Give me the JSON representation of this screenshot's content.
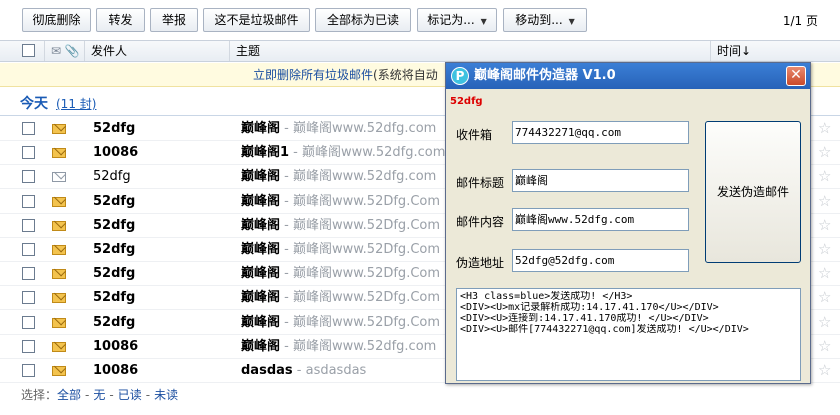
{
  "toolbar": {
    "delete_permanently": "彻底删除",
    "forward": "转发",
    "report": "举报",
    "not_spam": "这不是垃圾邮件",
    "mark_all_read": "全部标为已读",
    "mark_as": "标记为...",
    "move_to": "移动到...",
    "pager": "1/1 页"
  },
  "header": {
    "sender": "发件人",
    "subject": "主题",
    "time": "时间↓"
  },
  "notice": {
    "link": "立即删除所有垃圾邮件",
    "rest": "(系统将自动"
  },
  "group": {
    "title": "今天",
    "count": "(11 封)"
  },
  "mails": [
    {
      "sender": "52dfg",
      "bold": true,
      "title": "巅峰阁",
      "preview": " - 巅峰阁www.52dfg.com",
      "read": false
    },
    {
      "sender": "10086",
      "bold": true,
      "title": "巅峰阁1",
      "preview": " - 巅峰阁www.52dfg.com",
      "read": false
    },
    {
      "sender": "52dfg",
      "bold": false,
      "title": "巅峰阁",
      "preview": " - 巅峰阁www.52dfg.com",
      "read": true
    },
    {
      "sender": "52dfg",
      "bold": true,
      "title": "巅峰阁",
      "preview": " - 巅峰阁www.52Dfg.Com",
      "read": false
    },
    {
      "sender": "52dfg",
      "bold": true,
      "title": "巅峰阁",
      "preview": " - 巅峰阁www.52Dfg.Com",
      "read": false
    },
    {
      "sender": "52dfg",
      "bold": true,
      "title": "巅峰阁",
      "preview": " - 巅峰阁www.52Dfg.Com",
      "read": false
    },
    {
      "sender": "52dfg",
      "bold": true,
      "title": "巅峰阁",
      "preview": " - 巅峰阁www.52Dfg.Com",
      "read": false
    },
    {
      "sender": "52dfg",
      "bold": true,
      "title": "巅峰阁",
      "preview": " - 巅峰阁www.52Dfg.Com",
      "read": false
    },
    {
      "sender": "52dfg",
      "bold": true,
      "title": "巅峰阁",
      "preview": " - 巅峰阁www.52Dfg.Com",
      "read": false
    },
    {
      "sender": "10086",
      "bold": true,
      "title": "巅峰阁",
      "preview": " - 巅峰阁www.52dfg.com",
      "read": false
    },
    {
      "sender": "10086",
      "bold": true,
      "title": "dasdas",
      "preview": " - asdasdas",
      "read": false
    }
  ],
  "footer": {
    "label": "选择：",
    "all": "全部",
    "none": "无",
    "read": "已读",
    "unread": "未读",
    "sep": "-"
  },
  "dialog": {
    "title": "巅峰阁邮件伪造器  V1.0",
    "logo": "P",
    "close": "✕",
    "tag": "52dfg",
    "inbox_label": "收件箱",
    "inbox_value": "774432271@qq.com",
    "subject_label": "邮件标题",
    "subject_value": "巅峰阁",
    "content_label": "邮件内容",
    "content_value": "巅峰阁www.52dfg.com",
    "fake_label": "伪造地址",
    "fake_value": "52dfg@52dfg.com",
    "send_button": "发送伪造邮件",
    "log": [
      "<H3 class=blue>发送成功! </H3>",
      "<DIV><U>mx记录解析成功:14.17.41.170</U></DIV>",
      "<DIV><U>连接到:14.17.41.170成功! </U></DIV>",
      "<DIV><U>邮件[774432271@qq.com]发送成功! </U></DIV>"
    ]
  }
}
